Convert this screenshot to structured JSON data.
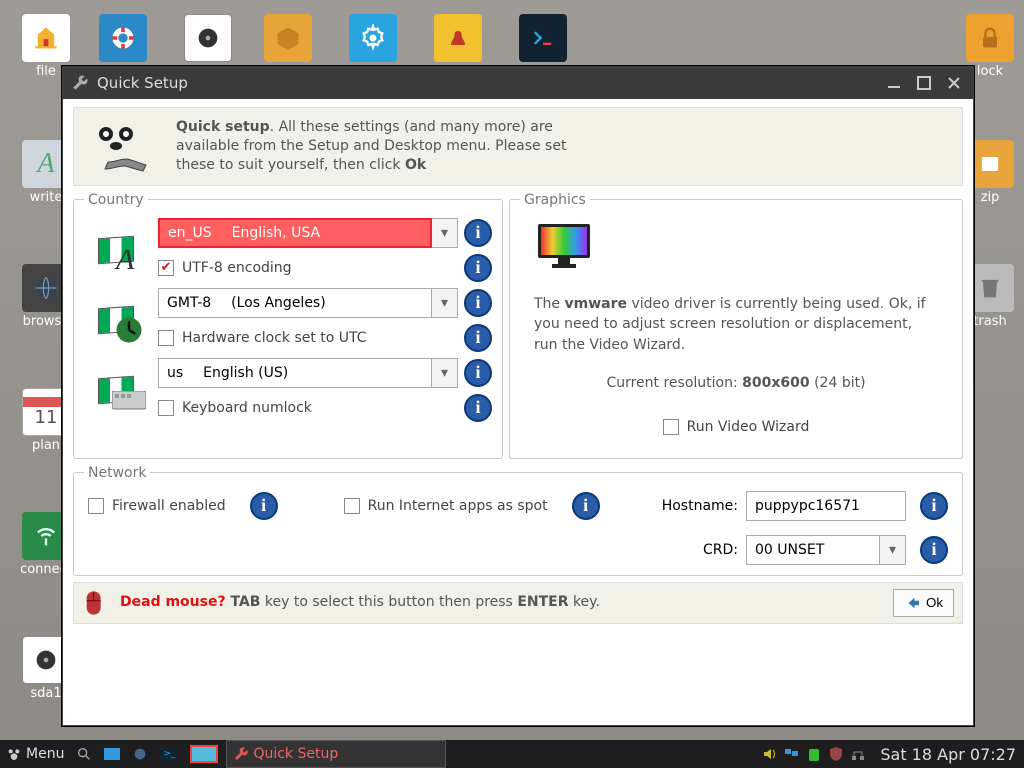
{
  "desktop_icons": {
    "file": "file",
    "write": "write",
    "browse": "browse",
    "plan": "plan",
    "connect": "connect",
    "sda1": "sda1",
    "lock": "lock",
    "zip": "zip",
    "trash": "trash"
  },
  "plan_day": "11",
  "window": {
    "title": "Quick Setup",
    "intro_bold": "Quick setup",
    "intro_rest": ". All these settings (and many more) are available from the Setup and Desktop menu. Please set these to suit yourself, then click ",
    "intro_ok": "Ok"
  },
  "country": {
    "legend": "Country",
    "locale_code": "en_US",
    "locale_name": "English, USA",
    "utf8_label": "UTF-8 encoding",
    "tz_code": "GMT-8",
    "tz_name": "(Los Angeles)",
    "hwclock_label": "Hardware clock set to UTC",
    "kb_code": "us",
    "kb_name": "English (US)",
    "numlock_label": "Keyboard numlock"
  },
  "graphics": {
    "legend": "Graphics",
    "line1a": "The ",
    "line1b": "vmware",
    "line1c": " video driver is currently being used. Ok, if you need to adjust screen resolution or displacement, run the Video Wizard.",
    "res_label": "Current resolution: ",
    "res_value": "800x600",
    "res_depth": "  (24 bit)",
    "wizard_label": "Run Video Wizard"
  },
  "network": {
    "legend": "Network",
    "firewall_label": "Firewall enabled",
    "spot_label": "Run Internet apps as spot",
    "hostname_label": "Hostname:",
    "hostname_value": "puppypc16571",
    "crd_label": "CRD:",
    "crd_value": "00 UNSET"
  },
  "footer": {
    "dead": "Dead mouse? ",
    "tab": "TAB",
    "mid": " key to select this button then press ",
    "enter": "ENTER",
    "end": " key.",
    "ok": "Ok"
  },
  "taskbar": {
    "menu": "Menu",
    "app": "Quick Setup",
    "clock": "Sat 18 Apr 07:27"
  }
}
